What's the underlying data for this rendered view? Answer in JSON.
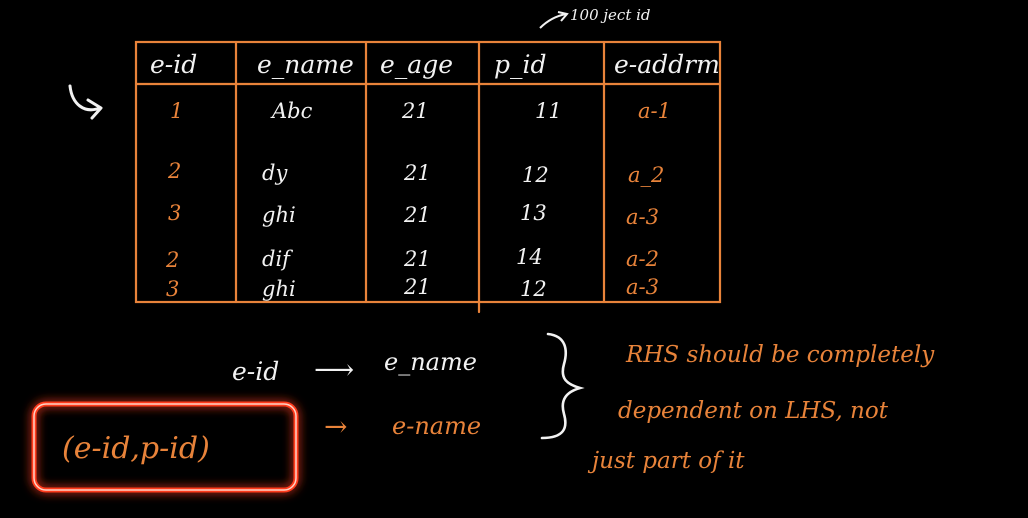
{
  "annotation_top": "100 ject id",
  "table": {
    "headers": [
      "e-id",
      "e_name",
      "e_age",
      "p_id",
      "e-addrm"
    ],
    "rows": [
      [
        "1",
        "Abc",
        "21",
        "11",
        "a-1"
      ],
      [
        "2",
        "dy",
        "21",
        "12",
        "a_2"
      ],
      [
        "3",
        "ghi",
        "21",
        "13",
        "a-3"
      ],
      [
        "2",
        "dif",
        "21",
        "14",
        "a-2"
      ],
      [
        "3",
        "ghi",
        "21",
        "12",
        "a-3"
      ]
    ]
  },
  "fd1": {
    "lhs": "e-id",
    "arrow": "⟶",
    "rhs": "e_name"
  },
  "fd2": {
    "lhs": "(e-id,p-id)",
    "arrow": "→",
    "rhs": "e-name"
  },
  "note": {
    "lines": [
      "RHS should be completely",
      "dependent on LHS, not",
      "just part of it"
    ]
  },
  "colors": {
    "orange": "#e8833a",
    "white": "#f2f2f2",
    "highlight": "#ff3b1f"
  }
}
